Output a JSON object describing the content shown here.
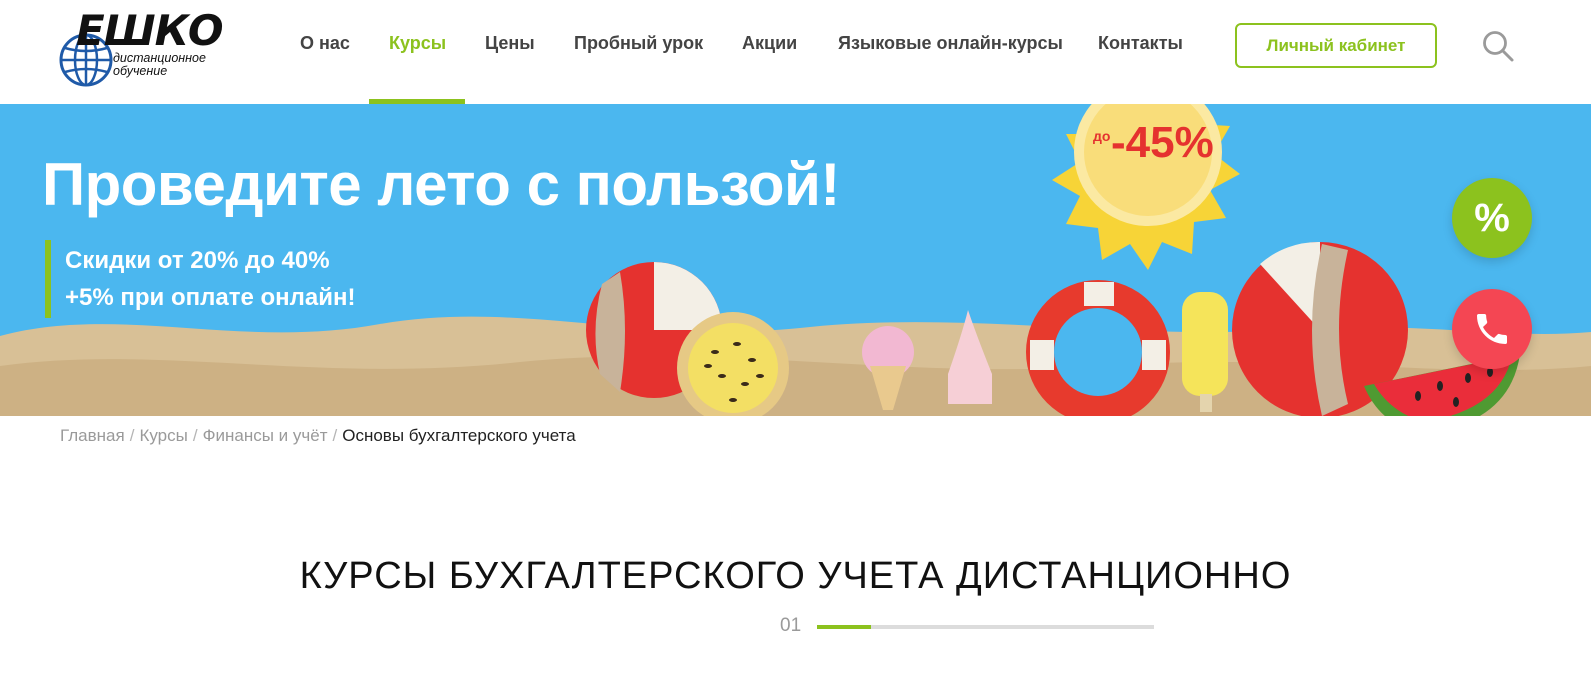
{
  "header": {
    "logo": {
      "word": "ЕШКО",
      "subtitle": "дистанционное обучение"
    },
    "nav": [
      {
        "label": "О нас",
        "active": false
      },
      {
        "label": "Курсы",
        "active": true
      },
      {
        "label": "Цены",
        "active": false
      },
      {
        "label": "Пробный урок",
        "active": false
      },
      {
        "label": "Акции",
        "active": false
      },
      {
        "label": "Языковые онлайн-курсы",
        "active": false
      },
      {
        "label": "Контакты",
        "active": false
      }
    ],
    "cabinet_label": "Личный кабинет",
    "search_icon": "search-icon"
  },
  "banner": {
    "title": "Проведите лето с пользой!",
    "line1": "Скидки от 20% до 40%",
    "line2": "+5% при оплате онлайн!",
    "sun_prefix": "до",
    "sun_value": "-45%"
  },
  "floating": {
    "discount_label": "%",
    "phone_icon": "phone-icon"
  },
  "breadcrumb": {
    "items": [
      "Главная",
      "Курсы",
      "Финансы и учёт"
    ],
    "current": "Основы бухгалтерского учета",
    "separator": "/"
  },
  "page": {
    "title": "КУРСЫ БУХГАЛТЕРСКОГО УЧЕТА ДИСТАНЦИОННО",
    "pager": "01",
    "progress_fraction": 0.16
  },
  "colors": {
    "accent": "#8cc21e",
    "banner_bg": "#4bb7ef",
    "phone": "#f44653"
  }
}
